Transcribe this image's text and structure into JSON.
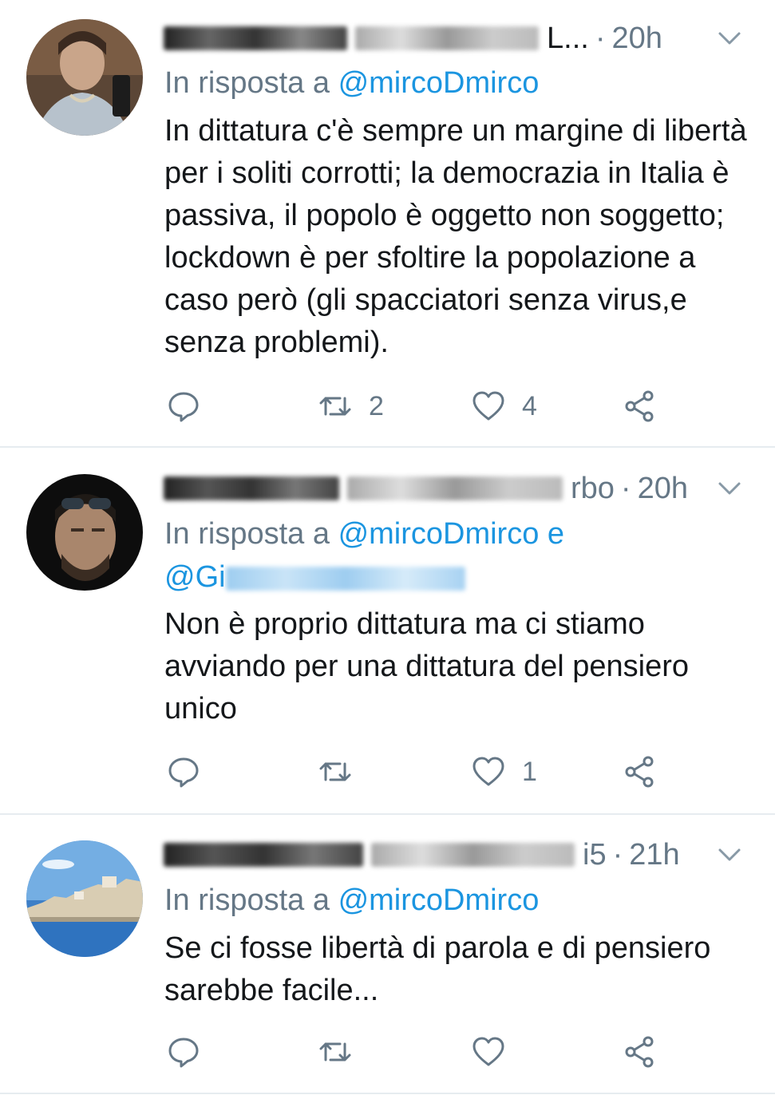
{
  "colors": {
    "text": "#14171a",
    "secondary": "#657786",
    "mention": "#1b95e0",
    "divider": "#e6ecf0"
  },
  "tweets": [
    {
      "name_tail": "L...",
      "time": "20h",
      "reply_prefix": "In risposta a",
      "reply_mention": "@mircoDmirco",
      "text": "In dittatura c'è sempre un margine di libertà per i soliti corrotti; la democrazia in Italia è passiva, il popolo è oggetto non soggetto; lockdown è per sfoltire la popolazione a caso però (gli spacciatori senza virus,e senza problemi).",
      "retweets": "2",
      "likes": "4"
    },
    {
      "name_tail": "rbo",
      "time": "20h",
      "reply_prefix": "In risposta a",
      "reply_mention": "@mircoDmirco",
      "reply_joiner": "e",
      "reply_mention2_visible": "@Gi",
      "text": "Non è proprio dittatura ma ci stiamo avviando per una dittatura del pensiero unico",
      "retweets": "",
      "likes": "1"
    },
    {
      "name_tail": "i5",
      "time": "21h",
      "reply_prefix": "In risposta a",
      "reply_mention": "@mircoDmirco",
      "text": "Se ci fosse libertà di parola e di pensiero sarebbe facile...",
      "retweets": "",
      "likes": ""
    }
  ],
  "icons": {
    "reply": "reply-icon",
    "retweet": "retweet-icon",
    "like": "heart-icon",
    "share": "share-icon",
    "more": "chevron-down-icon"
  }
}
